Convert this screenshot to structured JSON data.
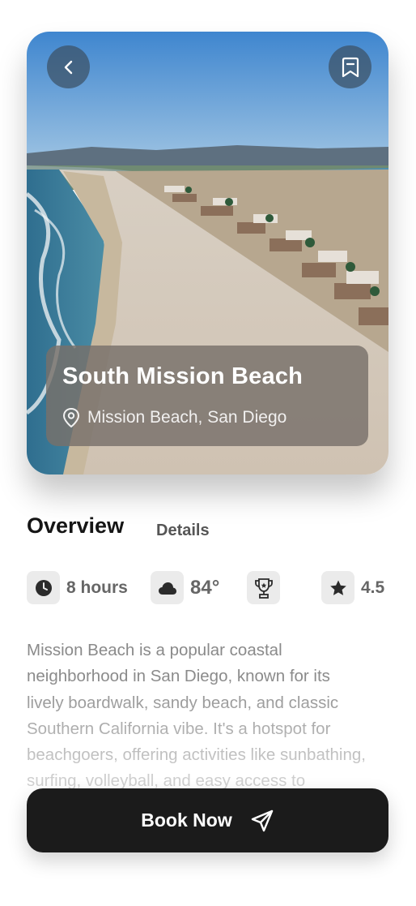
{
  "place": {
    "name": "South Mission Beach",
    "location": "Mission Beach, San Diego"
  },
  "tabs": {
    "overview": "Overview",
    "details": "Details"
  },
  "stats": {
    "duration": "8 hours",
    "temperature": "84°",
    "rating": "4.5"
  },
  "description": "Mission Beach is a popular coastal neighborhood in San Diego, known for its lively boardwalk, sandy beach, and classic Southern California vibe. It's a hotspot for beachgoers, offering activities like sunbathing, surfing, volleyball, and easy access to Belmont Park, a beachfront",
  "actions": {
    "book_label": "Book Now"
  },
  "icons": {
    "back": "chevron-left-icon",
    "bookmark": "bookmark-icon",
    "location": "location-pin-icon",
    "duration": "clock-icon",
    "weather": "cloud-icon",
    "award": "trophy-icon",
    "rating": "star-icon",
    "book": "send-icon"
  },
  "colors": {
    "button_bg": "#1b1b1b",
    "info_card": "#78706a",
    "text_muted": "#8a8a8a"
  }
}
